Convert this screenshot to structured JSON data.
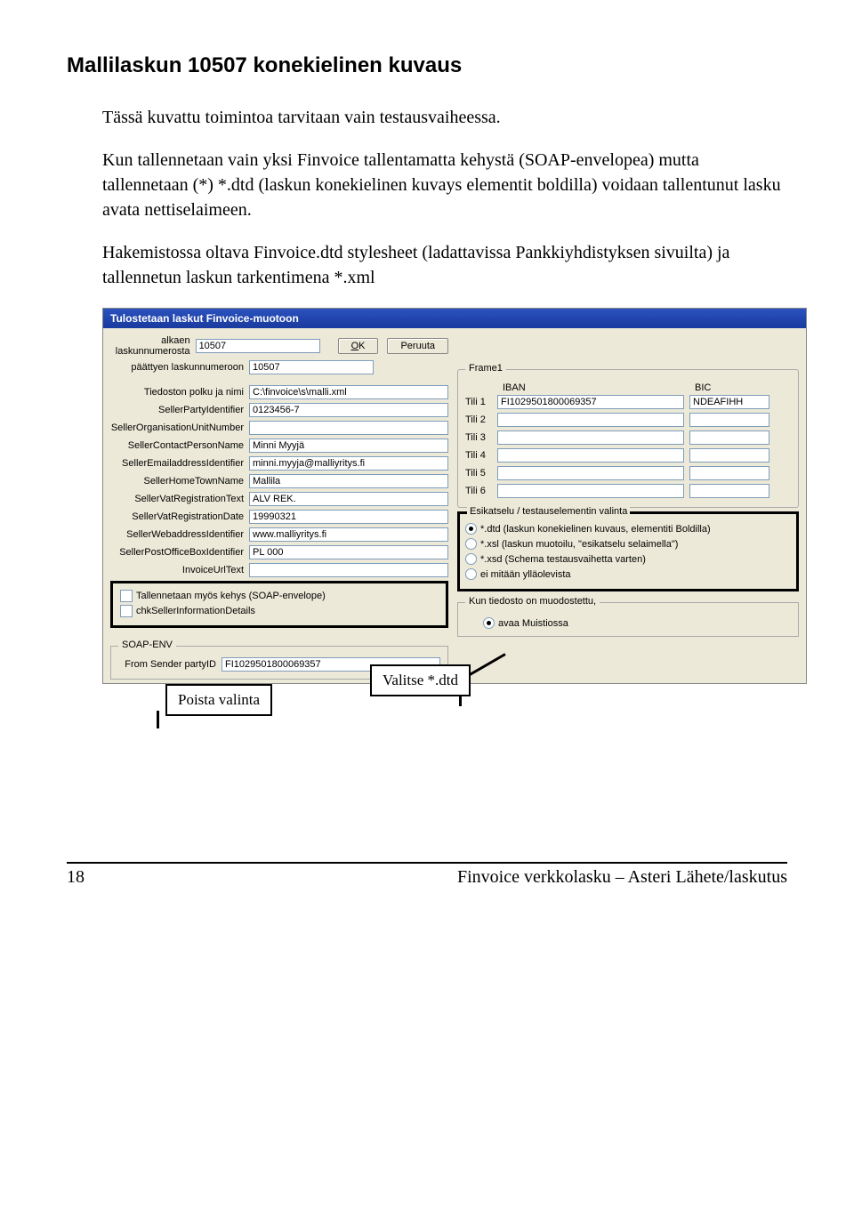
{
  "heading": "Mallilaskun 10507 konekielinen kuvaus",
  "para1": "Tässä kuvattu toimintoa tarvitaan vain testausvaiheessa.",
  "para2": "Kun tallennetaan vain yksi Finvoice tallentamatta kehystä (SOAP-envelopea) mutta tallennetaan (*) *.dtd (laskun konekielinen kuvays elementit boldilla) voidaan tallentunut lasku avata nettiselaimeen.",
  "para3": "Hakemistossa oltava Finvoice.dtd stylesheet (ladattavissa Pankkiyhdistyksen sivuilta) ja tallennetun laskun tarkentimena *.xml",
  "dialog": {
    "title": "Tulostetaan laskut Finvoice-muotoon",
    "ok": "OK",
    "ok_accel": "O",
    "cancel": "Peruuta",
    "labels": {
      "alkaen": "alkaen laskunnumerosta",
      "paattyen": "päättyen laskunnumeroon",
      "tiedoston": "Tiedoston polku ja nimi",
      "sellerParty": "SellerPartyIdentifier",
      "sellerOrg": "SellerOrganisationUnitNumber",
      "sellerContact": "SellerContactPersonName",
      "sellerEmail": "SellerEmailaddressIdentifier",
      "sellerHome": "SellerHomeTownName",
      "sellerVatReg": "SellerVatRegistrationText",
      "sellerVatDate": "SellerVatRegistrationDate",
      "sellerWeb": "SellerWebaddressIdentifier",
      "sellerPostBox": "SellerPostOfficeBoxIdentifier",
      "invoiceUrl": "InvoiceUrlText",
      "chkSoap": "Tallennetaan myös kehys (SOAP-envelope)",
      "chkSeller": "chkSellerInformationDetails",
      "soapenv": "SOAP-ENV",
      "fromSender": "From Sender partyID"
    },
    "values": {
      "alkaen": "10507",
      "paattyen": "10507",
      "tiedoston": "C:\\finvoice\\s\\malli.xml",
      "sellerParty": "0123456-7",
      "sellerOrg": "",
      "sellerContact": "Minni Myyjä",
      "sellerEmail": "minni.myyja@malliyritys.fi",
      "sellerHome": "Mallila",
      "sellerVatReg": "ALV REK.",
      "sellerVatDate": "19990321",
      "sellerWeb": "www.malliyritys.fi",
      "sellerPostBox": "PL 000",
      "invoiceUrl": "",
      "fromSender": "FI1029501800069357"
    },
    "frame1": "Frame1",
    "iban": "IBAN",
    "bic": "BIC",
    "tili": [
      "Tili 1",
      "Tili 2",
      "Tili 3",
      "Tili 4",
      "Tili 5",
      "Tili 6"
    ],
    "ibanVals": [
      "FI1029501800069357",
      "",
      "",
      "",
      "",
      ""
    ],
    "bicVals": [
      "NDEAFIHH",
      "",
      "",
      "",
      "",
      ""
    ],
    "esikatselu": "Esikatselu / testauselementin valinta",
    "radios": {
      "dtd": "*.dtd (laskun konekielinen kuvaus, elementiti Boldilla)",
      "xsl": "*.xsl (laskun muotoilu, \"esikatselu selaimella\")",
      "xsd": "*.xsd (Schema testausvaihetta varten)",
      "ei": "ei mitään ylläolevista"
    },
    "kunTitle": "Kun tiedosto on muodostettu,",
    "kunRadio": "avaa Muistiossa"
  },
  "callouts": {
    "poista": "Poista valinta",
    "valitse": "Valitse *.dtd"
  },
  "footer": {
    "page": "18",
    "text": "Finvoice verkkolasku – Asteri Lähete/laskutus"
  }
}
